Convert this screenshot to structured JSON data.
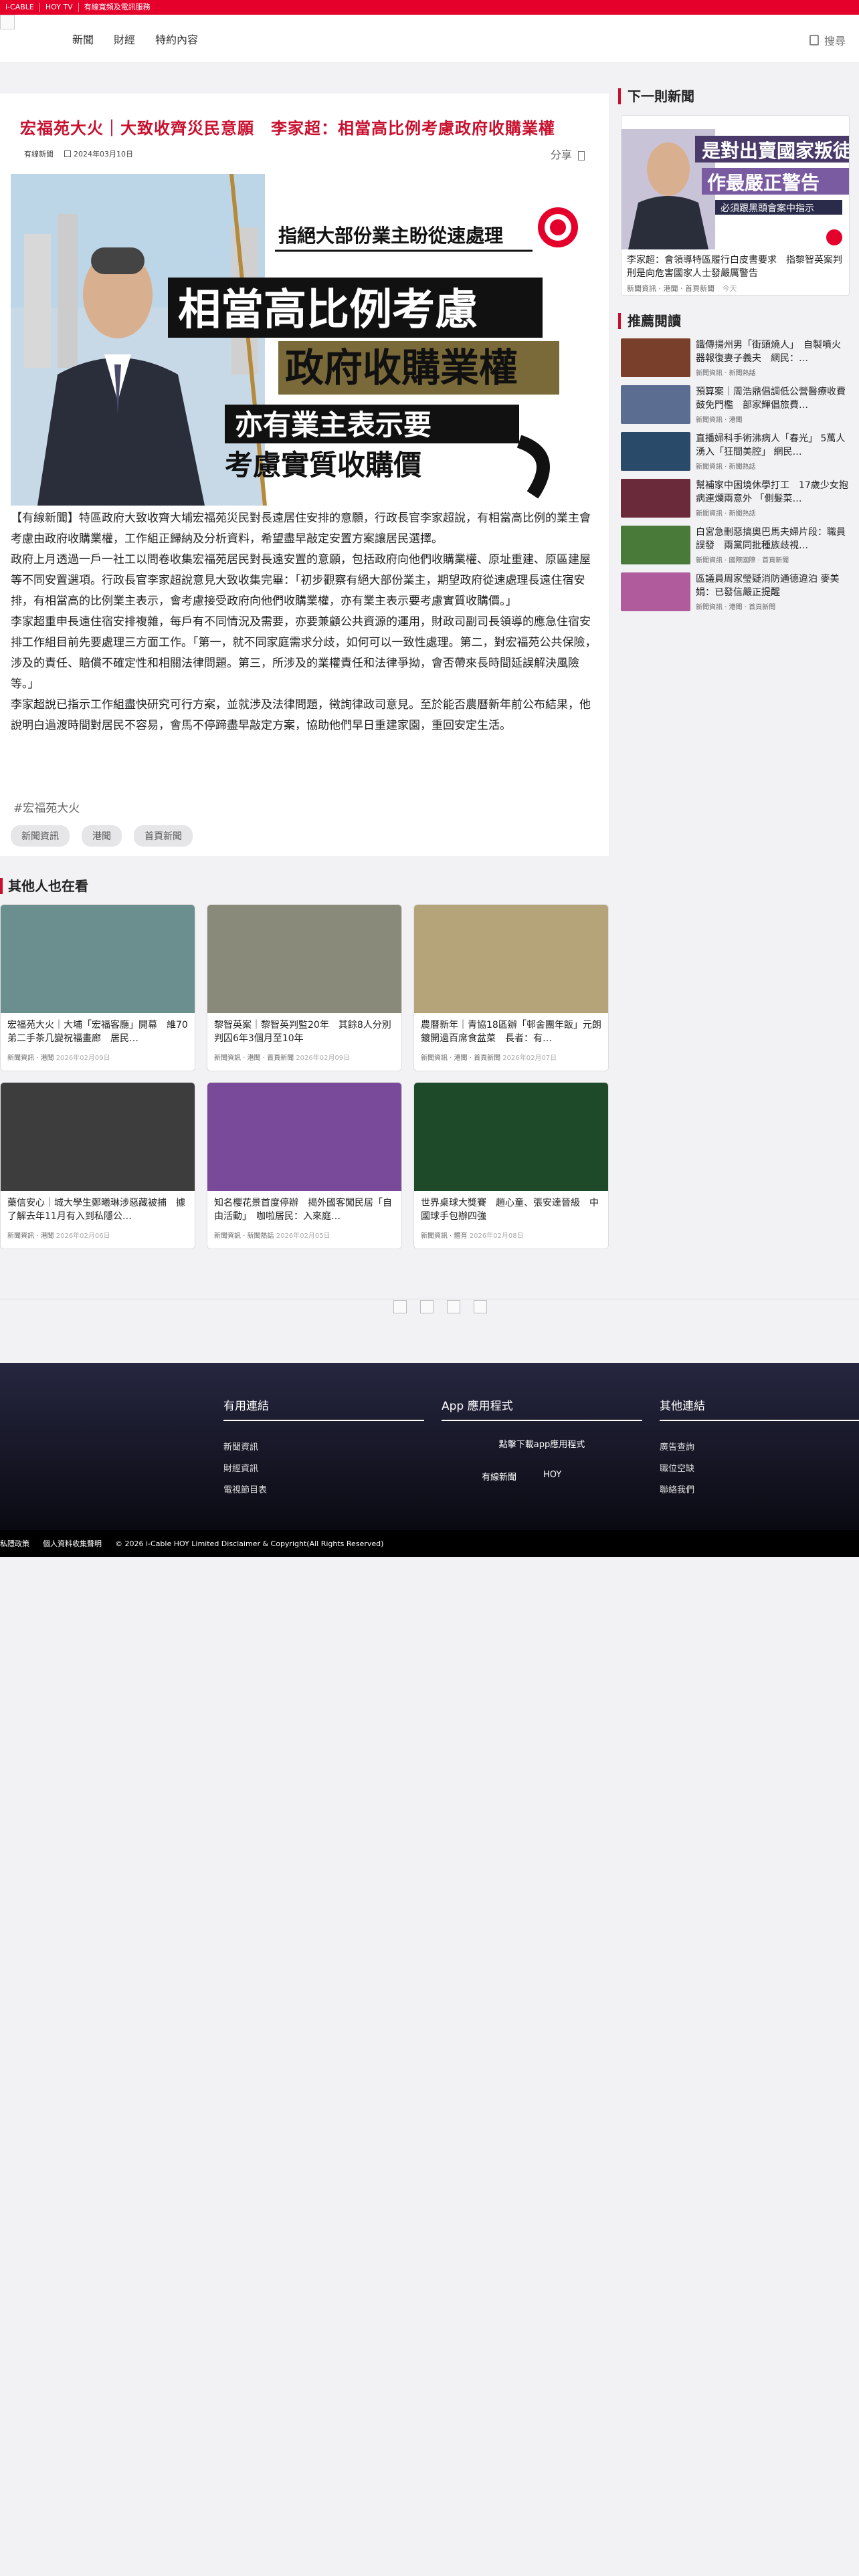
{
  "topbar": [
    "i-CABLE",
    "HOY TV",
    "有線寬頻及電訊服務"
  ],
  "nav": [
    "新聞",
    "財經",
    "特約內容"
  ],
  "search_label": "搜尋",
  "article": {
    "title": "宏福苑大火｜大致收齊災民意願　李家超：相當高比例考慮政府收購業權",
    "source": "有線新聞",
    "date": "2024年03月10日",
    "share": "分享",
    "hero": {
      "caption_top": "指絕大部份業主盼從速處理",
      "line1": "相當高比例考慮",
      "line2": "政府收購業權",
      "line3": "亦有業主表示要",
      "line4": "考慮實質收購價"
    },
    "paragraphs": [
      "【有線新聞】特區政府大致收齊大埔宏福苑災民對長遠居住安排的意願，行政長官李家超說，有相當高比例的業主會考慮由政府收購業權，工作組正歸納及分析資料，希望盡早敲定安置方案讓居民選擇。",
      "政府上月透過一戶一社工以問卷收集宏福苑居民對長遠安置的意願，包括政府向他們收購業權、原址重建、原區建屋等不同安置選項。行政長官李家超說意見大致收集完畢：「初步觀察有絕大部份業主，期望政府從速處理長遠住宿安排，有相當高的比例業主表示，會考慮接受政府向他們收購業權，亦有業主表示要考慮實質收購價。」",
      "李家超重申長遠住宿安排複雜，每戶有不同情況及需要，亦要兼顧公共資源的運用，財政司副司長領導的應急住宿安排工作組目前先要處理三方面工作。「第一，就不同家庭需求分歧，如何可以一致性處理。第二，對宏福苑公共保險，涉及的責任、賠償不確定性和相關法律問題。第三，所涉及的業權責任和法律爭拗，會否帶來長時間延誤解決風險等。」",
      "李家超說已指示工作組盡快研究可行方案，並就涉及法律問題，徵詢律政司意見。至於能否農曆新年前公布結果，他說明白過渡時間對居民不容易，會馬不停蹄盡早敲定方案，協助他們早日重建家園，重回安定生活。"
    ],
    "hashtag": "#宏福苑大火",
    "chips": [
      "新聞資訊",
      "港聞",
      "首頁新聞"
    ]
  },
  "sidebar": {
    "next_heading": "下一則新聞",
    "next": {
      "img_text1": "是對出賣國家叛徒",
      "img_text2": "作最嚴正警告",
      "img_text3": "必須跟黑頭會案中指示",
      "title": "李家超：會領導特區履行白皮書要求　指黎智英案判刑是向危害國家人士發嚴厲警告",
      "meta": "新聞資訊 · 港聞 · 首頁新聞",
      "when": "今天"
    },
    "rec_heading": "推薦閱讀",
    "rec": [
      {
        "title": "鐵傳揚州男「街頭燒人」　自製噴火器報復妻子義夫　網民：…",
        "meta": "新聞資訊 · 新聞熱話",
        "color": "#7a3f2a"
      },
      {
        "title": "預算案｜周浩鼎倡調低公營醫療收費鼓免門檻　部家輝倡旅費…",
        "meta": "新聞資訊 · 港聞",
        "color": "#5b6e91"
      },
      {
        "title": "直播婦科手術沸病人「春光」 5萬人湧入「狂間美腔」 網民…",
        "meta": "新聞資訊 · 新聞熱話",
        "color": "#2a4a6a"
      },
      {
        "title": "幫補家中困境休學打工　17歲少女抱病連爛兩意外 「側髮菜…",
        "meta": "新聞資訊 · 新聞熱話",
        "color": "#6a2a3a"
      },
      {
        "title": "白宮急刪惡搞奧巴馬夫婦片段：職員誤發　兩黨同批種族歧視…",
        "meta": "新聞資訊 · 國際國際 · 首頁新聞",
        "color": "#4a7a3a"
      },
      {
        "title": "區議員周家瑩疑消防通德違泊 麥美娟：已發信嚴正提醒",
        "meta": "新聞資訊 · 港聞 · 首頁新聞",
        "color": "#b05c9c"
      }
    ]
  },
  "others": {
    "heading": "其他人也在看",
    "cards": [
      {
        "title": "宏福苑大火｜大埔「宏福客廳」開幕　維70弟二手茶几變祝福畫廊　居民…",
        "meta": "新聞資訊 · 港聞",
        "date": "2026年02月09日",
        "color": "#6b8e8f"
      },
      {
        "title": "黎智英案｜黎智英判監20年　其餘8人分別判囚6年3個月至10年",
        "meta": "新聞資訊 · 港聞 · 首頁新聞",
        "date": "2026年02月09日",
        "color": "#8a8a7a"
      },
      {
        "title": "農曆新年｜青協18區辦「邨舍團年飯」元朗鍍開過百席食盆菜　長者：有…",
        "meta": "新聞資訊 · 港聞 · 首頁新聞",
        "date": "2026年02月07日",
        "color": "#b5a47a"
      },
      {
        "title": "藥信安心｜城大學生鄭曦琳涉惡藏被捕　據了解去年11月有入到私隱公…",
        "meta": "新聞資訊 · 港聞",
        "date": "2026年02月06日",
        "color": "#3d3d3d"
      },
      {
        "title": "知名櫻花景首度停辦　揭外國客闖民居「自由活動」　咖啦居民：入來庭…",
        "meta": "新聞資訊 · 新聞熱話",
        "date": "2026年02月05日",
        "color": "#7a4a9a"
      },
      {
        "title": "世界桌球大獎賽　趙心童、張安達晉級　中國球手包辦四強",
        "meta": "新聞資訊 · 體育",
        "date": "2026年02月08日",
        "color": "#1f4a2a"
      }
    ]
  },
  "footer": {
    "col1_title": "有用連結",
    "col1_links": [
      "新聞資訊",
      "財經資訊",
      "電視節目表"
    ],
    "col2_title": "App 應用程式",
    "col2_text": "點擊下載app應用程式",
    "col2_apps": [
      "有線新聞",
      "HOY"
    ],
    "col3_title": "其他連結",
    "col3_links": [
      "廣告查詢",
      "職位空缺",
      "聯絡我們"
    ],
    "bottom": [
      "私隱政策",
      "個人資料收集聲明",
      "© 2026 i-Cable HOY Limited Disclaimer & Copyright(All Rights Reserved)"
    ]
  },
  "colors": {
    "brand_red": "#e4002b",
    "title_red": "#c8102e",
    "footer_dark": "#1a1a2e"
  }
}
